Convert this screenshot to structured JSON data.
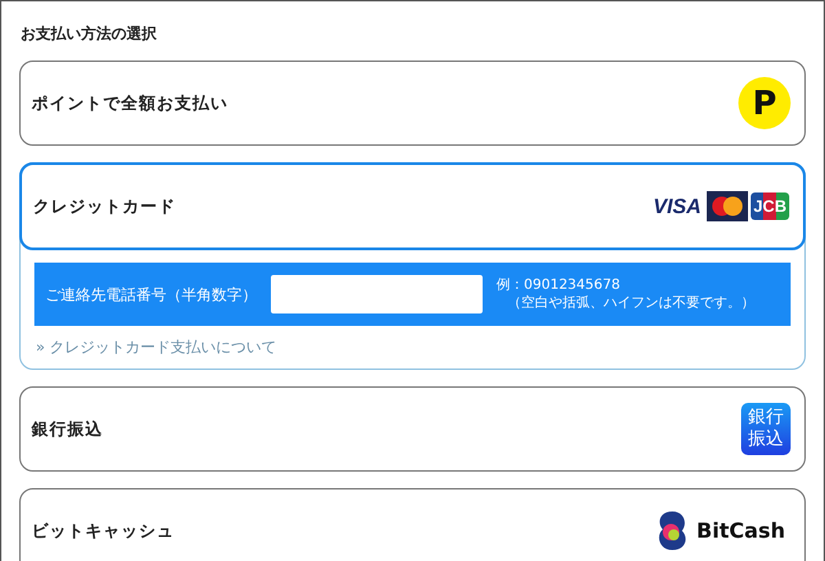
{
  "title": "お支払い方法の選択",
  "options": [
    {
      "kind": "points",
      "label": "ポイントで全額お支払い",
      "selected": false,
      "expanded": false,
      "logo_text": [
        "P"
      ]
    },
    {
      "kind": "card",
      "label": "クレジットカード",
      "selected": true,
      "expanded": true,
      "logo_text": [
        "VISA",
        "JCB"
      ],
      "details": {
        "field_label": "ご連絡先電話番号（半角数字）",
        "example": "例：09012345678",
        "note": "（空白や括弧、ハイフンは不要です。）",
        "link": "» クレジットカード支払いについて"
      }
    },
    {
      "kind": "bank",
      "label": "銀行振込",
      "selected": false,
      "expanded": false,
      "logo_text": [
        "銀行",
        "振込"
      ]
    },
    {
      "kind": "bitcash",
      "label": "ビットキャッシュ",
      "selected": false,
      "expanded": false,
      "logo_text": [
        "BitCash"
      ]
    }
  ]
}
